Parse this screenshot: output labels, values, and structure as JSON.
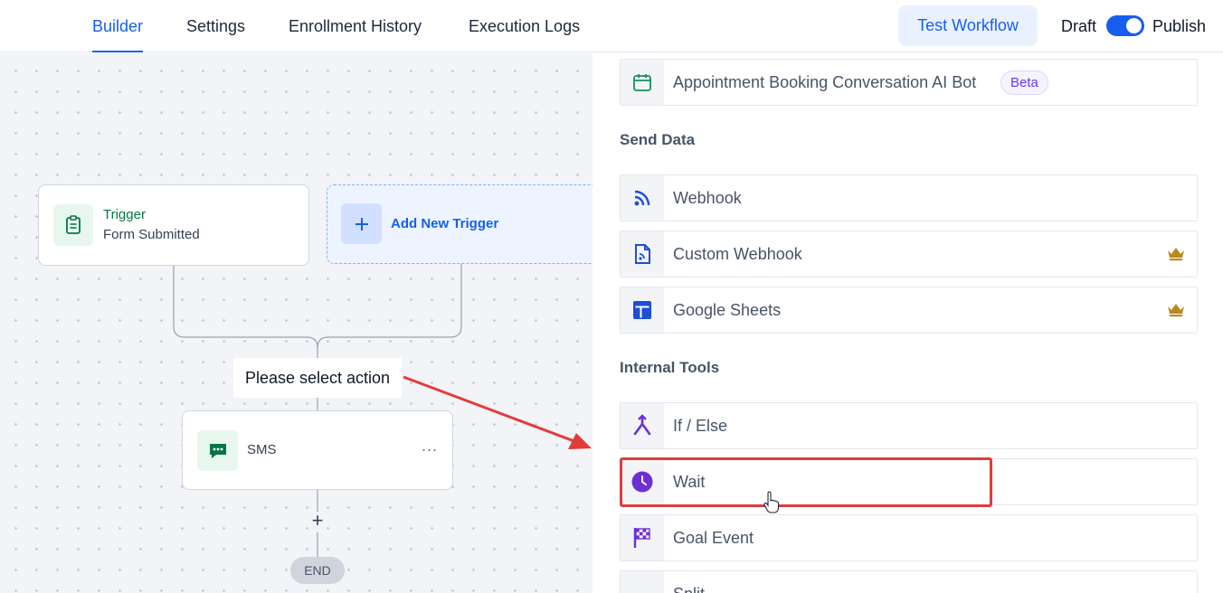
{
  "header": {
    "tabs": [
      {
        "label": "Builder",
        "active": true
      },
      {
        "label": "Settings",
        "active": false
      },
      {
        "label": "Enrollment History",
        "active": false
      },
      {
        "label": "Execution Logs",
        "active": false
      }
    ],
    "test_button": "Test Workflow",
    "draft_label": "Draft",
    "publish_label": "Publish",
    "publish_toggle_on": true
  },
  "canvas": {
    "trigger": {
      "title": "Trigger",
      "subtitle": "Form Submitted",
      "icon": "clipboard-icon"
    },
    "add_trigger": {
      "label": "Add New Trigger",
      "icon": "plus-icon"
    },
    "select_action_label": "Please select action",
    "sms_node": {
      "label": "SMS",
      "icon": "chat-icon",
      "menu": "..."
    },
    "add_step": "+",
    "end_label": "END"
  },
  "panel": {
    "top_item": {
      "label": "Appointment Booking Conversation AI Bot",
      "badge": "Beta",
      "icon": "calendar-icon"
    },
    "sections": [
      {
        "title": "Send Data",
        "items": [
          {
            "label": "Webhook",
            "icon": "rss-icon",
            "premium": false
          },
          {
            "label": "Custom Webhook",
            "icon": "file-code-icon",
            "premium": true
          },
          {
            "label": "Google Sheets",
            "icon": "sheets-icon",
            "premium": true
          }
        ]
      },
      {
        "title": "Internal Tools",
        "items": [
          {
            "label": "If / Else",
            "icon": "branch-icon",
            "premium": false
          },
          {
            "label": "Wait",
            "icon": "clock-icon",
            "premium": false,
            "highlighted": true
          },
          {
            "label": "Goal Event",
            "icon": "flag-icon",
            "premium": false
          },
          {
            "label": "Split",
            "icon": "split-icon",
            "premium": false
          }
        ]
      }
    ]
  },
  "colors": {
    "accent": "#155eef",
    "trigger_green": "#067647",
    "premium_gold": "#b88a1b",
    "highlight_red": "#e03c3c",
    "internal_purple": "#6d2fd6"
  }
}
